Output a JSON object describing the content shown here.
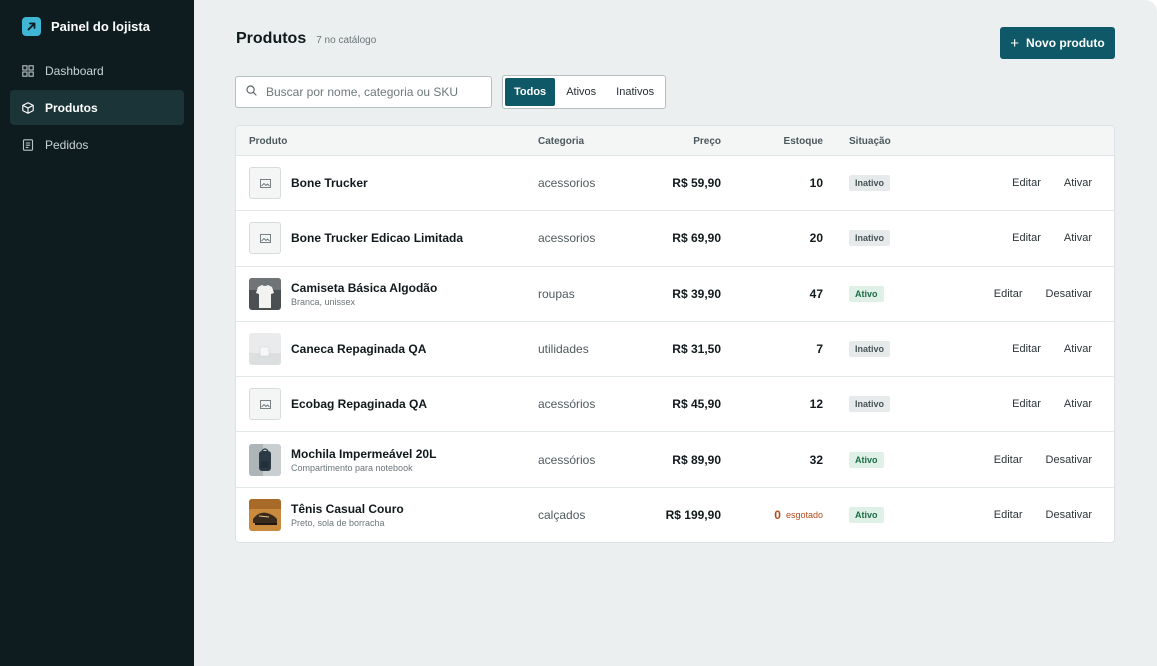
{
  "sidebar": {
    "brand": "Painel do lojista",
    "items": [
      {
        "label": "Dashboard",
        "icon": "grid-icon",
        "active": false
      },
      {
        "label": "Produtos",
        "icon": "box-icon",
        "active": true
      },
      {
        "label": "Pedidos",
        "icon": "receipt-icon",
        "active": false
      }
    ]
  },
  "header": {
    "title": "Produtos",
    "count": "7 no catálogo",
    "new_button": "Novo produto"
  },
  "search": {
    "placeholder": "Buscar por nome, categoria ou SKU",
    "value": ""
  },
  "filters": {
    "options": [
      "Todos",
      "Ativos",
      "Inativos"
    ],
    "selected": "Todos"
  },
  "table": {
    "columns": {
      "product": "Produto",
      "category": "Categoria",
      "price": "Preço",
      "stock": "Estoque",
      "status": "Situação"
    },
    "rows": [
      {
        "name": "Bone Trucker",
        "subtitle": "",
        "category": "acessorios",
        "price": "R$ 59,90",
        "stock": "10",
        "stock_note": "",
        "status": "Inativo",
        "actions": [
          "Editar",
          "Ativar"
        ]
      },
      {
        "name": "Bone Trucker Edicao Limitada",
        "subtitle": "",
        "category": "acessorios",
        "price": "R$ 69,90",
        "stock": "20",
        "stock_note": "",
        "status": "Inativo",
        "actions": [
          "Editar",
          "Ativar"
        ]
      },
      {
        "name": "Camiseta Básica Algodão",
        "subtitle": "Branca, unissex",
        "category": "roupas",
        "price": "R$ 39,90",
        "stock": "47",
        "stock_note": "",
        "status": "Ativo",
        "actions": [
          "Editar",
          "Desativar"
        ]
      },
      {
        "name": "Caneca Repaginada QA",
        "subtitle": "",
        "category": "utilidades",
        "price": "R$ 31,50",
        "stock": "7",
        "stock_note": "",
        "status": "Inativo",
        "actions": [
          "Editar",
          "Ativar"
        ]
      },
      {
        "name": "Ecobag Repaginada QA",
        "subtitle": "",
        "category": "acessórios",
        "price": "R$ 45,90",
        "stock": "12",
        "stock_note": "",
        "status": "Inativo",
        "actions": [
          "Editar",
          "Ativar"
        ]
      },
      {
        "name": "Mochila Impermeável 20L",
        "subtitle": "Compartimento para notebook",
        "category": "acessórios",
        "price": "R$ 89,90",
        "stock": "32",
        "stock_note": "",
        "status": "Ativo",
        "actions": [
          "Editar",
          "Desativar"
        ]
      },
      {
        "name": "Tênis Casual Couro",
        "subtitle": "Preto, sola de borracha",
        "category": "calçados",
        "price": "R$ 199,90",
        "stock": "0",
        "stock_note": "esgotado",
        "status": "Ativo",
        "actions": [
          "Editar",
          "Desativar"
        ]
      }
    ]
  },
  "colors": {
    "accent": "#0e5867",
    "sidebar_bg": "#0f1c1f",
    "brand_icon": "#3fb6d3",
    "status_active": "#1d6b47",
    "out_of_stock": "#b24a1c"
  }
}
